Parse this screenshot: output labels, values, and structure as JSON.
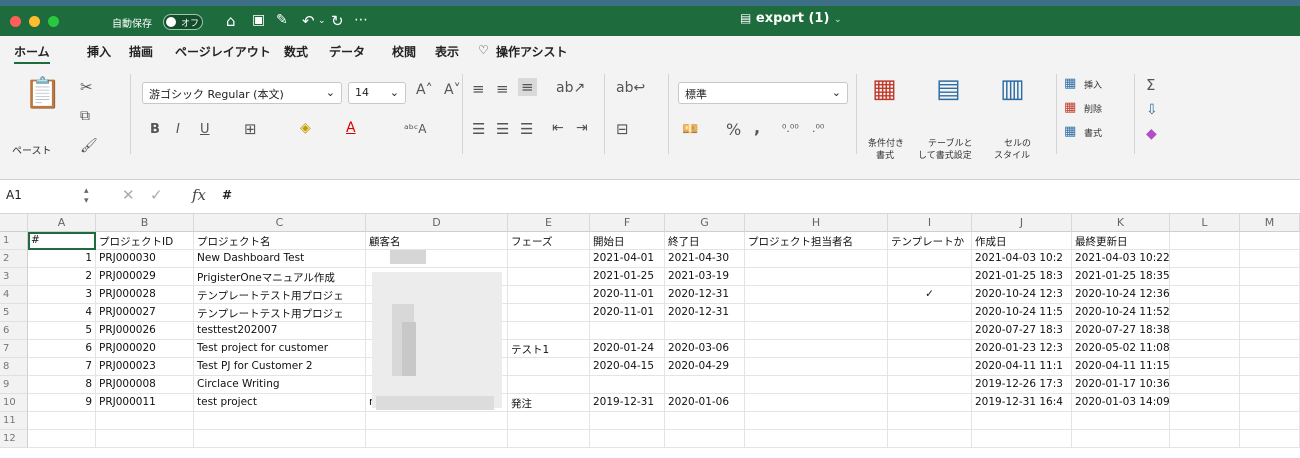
{
  "titlebar": {
    "autosave_label": "自動保存",
    "autosave_state": "オフ",
    "doc_title": "export (1)",
    "icons": [
      "home-icon",
      "save-icon",
      "save-as-icon",
      "undo-icon",
      "redo-icon",
      "more-icon"
    ]
  },
  "menu": {
    "items": [
      "ホーム",
      "挿入",
      "描画",
      "ページレイアウト",
      "数式",
      "データ",
      "校閲",
      "表示"
    ],
    "tell_me": "操作アシスト"
  },
  "ribbon": {
    "paste_label": "ペースト",
    "font_name": "游ゴシック Regular (本文)",
    "font_size": "14",
    "number_format": "標準",
    "conditional_label_1": "条件付き",
    "conditional_label_2": "書式",
    "table_label_1": "テーブルと",
    "table_label_2": "して書式設定",
    "cellstyle_label_1": "セルの",
    "cellstyle_label_2": "スタイル",
    "insert_label": "挿入",
    "delete_label": "削除",
    "format_label": "書式"
  },
  "formula": {
    "namebox": "A1",
    "fx": "fx",
    "content": "#"
  },
  "columns": [
    "A",
    "B",
    "C",
    "D",
    "E",
    "F",
    "G",
    "H",
    "I",
    "J",
    "K",
    "L",
    "M"
  ],
  "rows": [
    [
      "#",
      "プロジェクトID",
      "プロジェクト名",
      "顧客名",
      "フェーズ",
      "開始日",
      "終了日",
      "プロジェクト担当者名",
      "テンプレートか",
      "作成日",
      "最終更新日",
      "",
      ""
    ],
    [
      "1",
      "PRJ000030",
      "New Dashboard Test",
      "",
      "",
      "2021-04-01",
      "2021-04-30",
      "",
      "",
      "2021-04-03 10:2",
      "2021-04-03 10:22:18",
      "",
      ""
    ],
    [
      "2",
      "PRJ000029",
      "PrigisterOneマニュアル作成",
      "",
      "",
      "2021-01-25",
      "2021-03-19",
      "",
      "",
      "2021-01-25 18:3",
      "2021-01-25 18:35:51",
      "",
      ""
    ],
    [
      "3",
      "PRJ000028",
      "テンプレートテスト用プロジェ",
      "",
      "",
      "2020-11-01",
      "2020-12-31",
      "",
      "✓",
      "2020-10-24 12:3",
      "2020-10-24 12:36:12",
      "",
      ""
    ],
    [
      "4",
      "PRJ000027",
      "テンプレートテスト用プロジェ",
      "",
      "",
      "2020-11-01",
      "2020-12-31",
      "",
      "",
      "2020-10-24 11:5",
      "2020-10-24 11:52:29",
      "",
      ""
    ],
    [
      "5",
      "PRJ000026",
      "testtest202007",
      "",
      "",
      "",
      "",
      "",
      "",
      "2020-07-27 18:3",
      "2020-07-27 18:38:50",
      "",
      ""
    ],
    [
      "6",
      "PRJ000020",
      "Test project for customer",
      "",
      "テスト1",
      "2020-01-24",
      "2020-03-06",
      "",
      "",
      "2020-01-23 12:3",
      "2020-05-02 11:08:03",
      "",
      ""
    ],
    [
      "7",
      "PRJ000023",
      "Test PJ for Customer 2",
      "",
      "",
      "2020-04-15",
      "2020-04-29",
      "",
      "",
      "2020-04-11 11:1",
      "2020-04-11 11:15:43",
      "",
      ""
    ],
    [
      "8",
      "PRJ000008",
      "Circlace Writing",
      "",
      "",
      "",
      "",
      "",
      "",
      "2019-12-26 17:3",
      "2020-01-17 10:36:24",
      "",
      ""
    ],
    [
      "9",
      "PRJ000011",
      "test project",
      "r",
      "発注",
      "2019-12-31",
      "2020-01-06",
      "",
      "",
      "2019-12-31 16:4",
      "2020-01-03 14:09:00",
      "",
      ""
    ],
    [
      "",
      "",
      "",
      "",
      "",
      "",
      "",
      "",
      "",
      "",
      "",
      "",
      ""
    ],
    [
      "",
      "",
      "",
      "",
      "",
      "",
      "",
      "",
      "",
      "",
      "",
      "",
      ""
    ]
  ],
  "row_numbers": [
    "1",
    "2",
    "3",
    "4",
    "5",
    "6",
    "7",
    "8",
    "9",
    "10",
    "11",
    "12"
  ]
}
